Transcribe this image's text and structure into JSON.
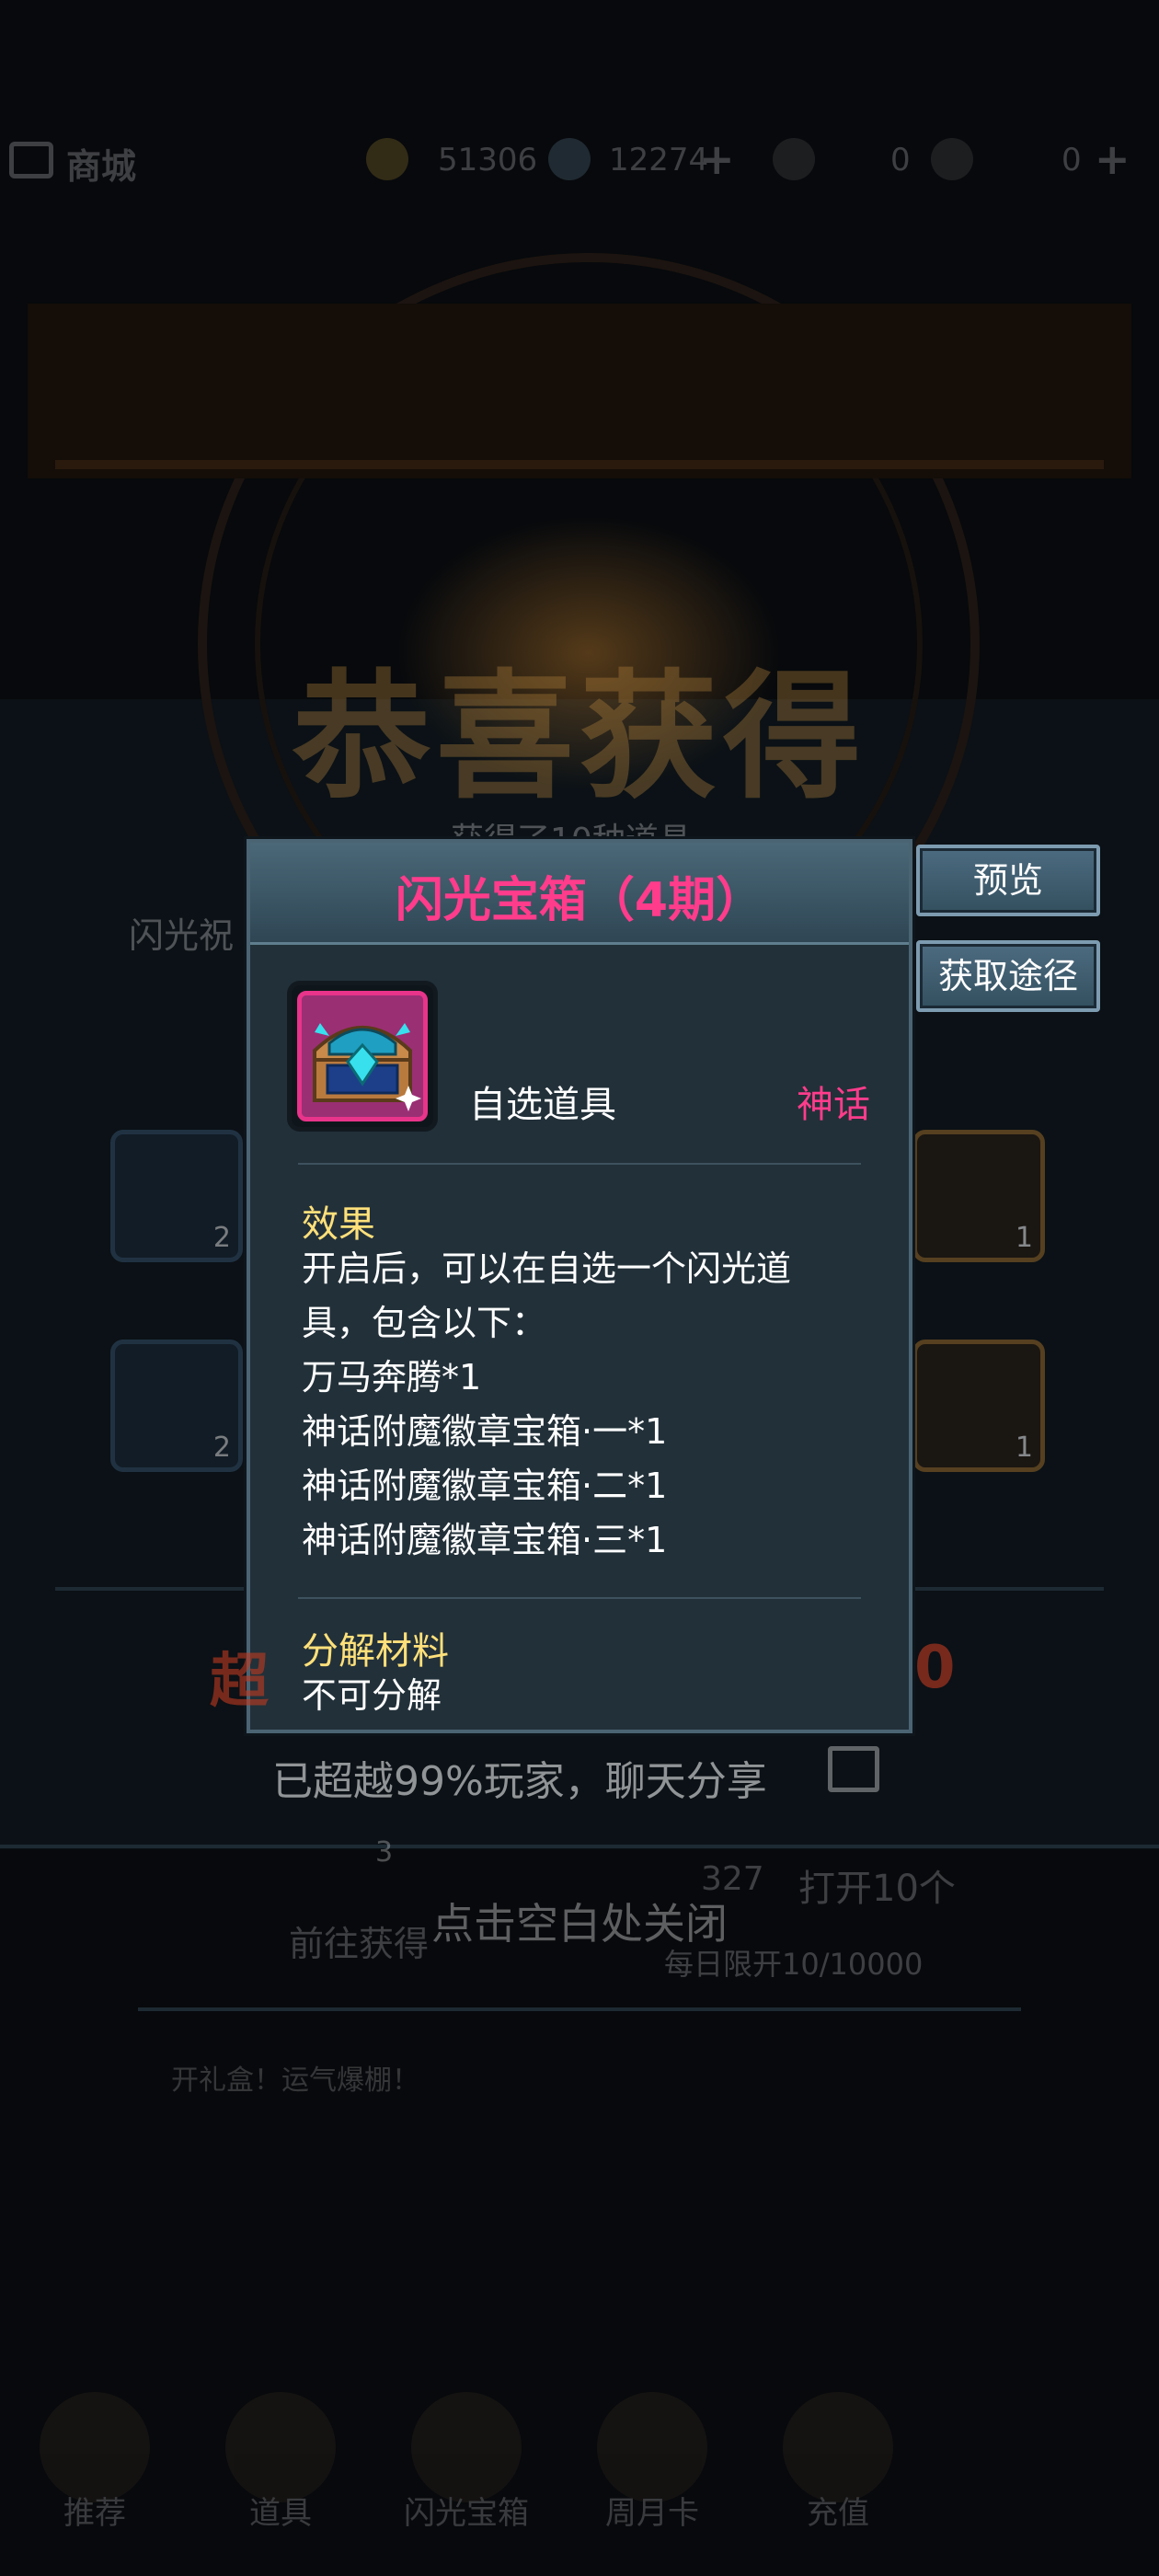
{
  "header": {
    "title": "商城",
    "gold": "51306",
    "gems": "12274",
    "ticket_a": "0",
    "ticket_b": "0"
  },
  "banner": {
    "title": "恭喜获得",
    "subtitle": "获得了10种道具",
    "progress_label": "闪光祝"
  },
  "side_buttons": {
    "preview": "预览",
    "source": "获取途径"
  },
  "popup": {
    "title": "闪光宝箱（4期）",
    "item_type": "自选道具",
    "rarity": "神话",
    "effect_title": "效果",
    "effect_lines": [
      "开启后，可以在自选一个闪光道",
      "具，包含以下：",
      "万马奔腾*1",
      "神话附魔徽章宝箱·一*1",
      "神话附魔徽章宝箱·二*1",
      "神话附魔徽章宝箱·三*1"
    ],
    "decompose_title": "分解材料",
    "decompose_value": "不可分解"
  },
  "background_items": {
    "left_count_1": "2",
    "left_count_2": "2",
    "right_count_1": "1",
    "right_count_2": "1"
  },
  "bottom": {
    "red_left": "超",
    "red_right": "0",
    "share_text": "已超越99%玩家，聊天分享",
    "close_hint": "点击空白处关闭",
    "goto_button": "前往获得",
    "open_button": "打开10个",
    "cost": "327",
    "daily_limit": "每日限开10/10000",
    "tip": "开礼盒！运气爆棚！",
    "qty": "3"
  },
  "nav": [
    "推荐",
    "道具",
    "闪光宝箱",
    "周月卡",
    "充值"
  ],
  "colors": {
    "title_pink": "#ff3c8c",
    "rarity_pink": "#ff3c8c",
    "section_yellow": "#ffe07a",
    "popup_bg": "#223039"
  }
}
